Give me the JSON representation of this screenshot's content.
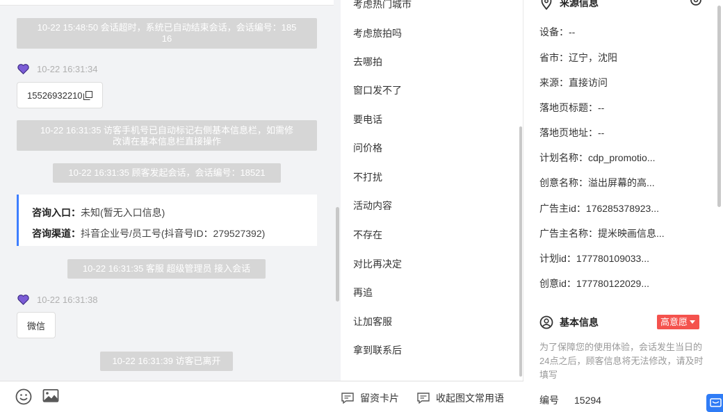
{
  "chat": {
    "sys1": [
      "10-22 15:48:50 会话超时，系统已自动结束会话，会话编号：185",
      "16"
    ],
    "msg1_time": "10-22 16:31:34",
    "msg1_text": "15526932210",
    "sys2": [
      "10-22 16:31:35 访客手机号已自动标记右侧基本信息栏，如需修",
      "改请在基本信息栏直接操作"
    ],
    "sys3": "10-22 16:31:35 顾客发起会话，会话编号：18521",
    "card": {
      "entry_label": "咨询入口：",
      "entry_value": "未知(暂无入口信息)",
      "channel_label": "咨询渠道：",
      "channel_value": "抖音企业号/员工号(抖音号ID：279527392)"
    },
    "sys4": "10-22 16:31:35 客服 超级管理员 接入会话",
    "msg2_time": "10-22 16:31:38",
    "msg2_text": "微信",
    "sys5": "10-22 16:31:39 访客已离开"
  },
  "toolbar": {
    "emoji_icon": "smiley-icon",
    "image_icon": "image-icon",
    "card_label": "留资卡片",
    "collapse_label": "收起图文常用语"
  },
  "phrases": [
    "考虑热门城市",
    "考虑旅拍吗",
    "去哪拍",
    "窗口发不了",
    "要电话",
    "问价格",
    "不打扰",
    "活动内容",
    "不存在",
    "对比再决定",
    "再追",
    "让加客服",
    "拿到联系后"
  ],
  "panel": {
    "source_title": "来源信息",
    "fields": [
      {
        "label": "设备：",
        "value": "--"
      },
      {
        "label": "省市：",
        "value": "辽宁，沈阳"
      },
      {
        "label": "来源：",
        "value": "直接访问"
      },
      {
        "label": "落地页标题：",
        "value": "--"
      },
      {
        "label": "落地页地址：",
        "value": "--"
      },
      {
        "label": "计划名称：",
        "value": "cdp_promotio..."
      },
      {
        "label": "创意名称：",
        "value": "溢出屏幕的高..."
      },
      {
        "label": "广告主id：",
        "value": "176285378923..."
      },
      {
        "label": "广告主名称：",
        "value": "提米映画信息..."
      },
      {
        "label": "计划id：",
        "value": "177780109033..."
      },
      {
        "label": "创意id：",
        "value": "177780122029..."
      }
    ],
    "basic_title": "基本信息",
    "intent_badge": "高意愿",
    "note": "为了保障您的使用体验，会话发生当日的24点之后，顾客信息将无法修改，请及时填写",
    "id_label": "编号",
    "id_value": "15294"
  },
  "colors": {
    "accent": "#3d7eff",
    "badge": "#f4524d",
    "heart": "#7b5cd6",
    "system_bubble": "#d6d6d6"
  }
}
